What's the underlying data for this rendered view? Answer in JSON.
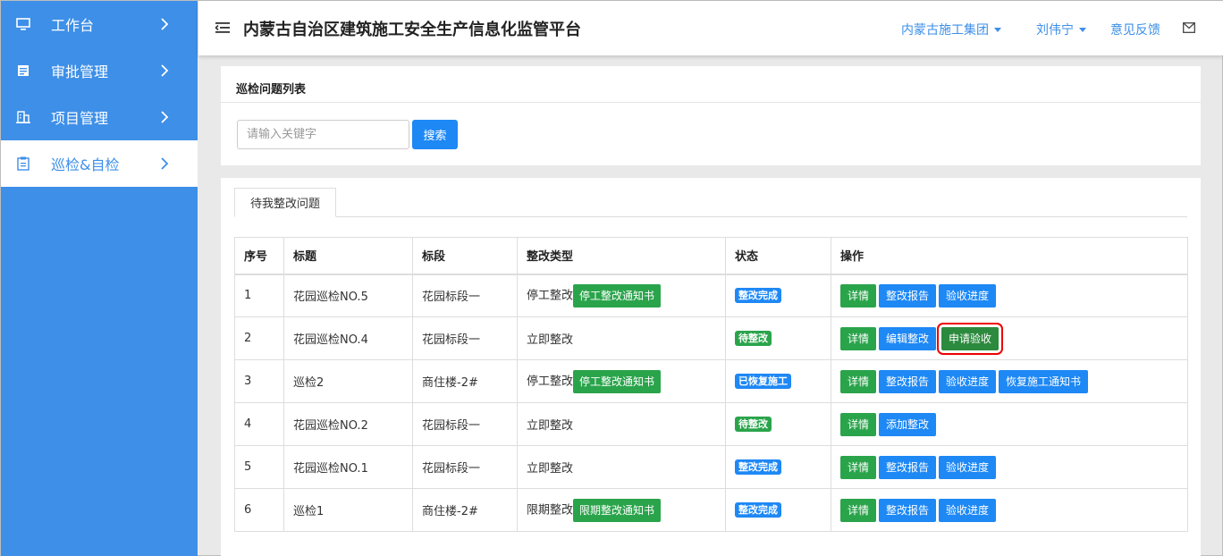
{
  "sidebar": {
    "items": [
      {
        "label": "工作台",
        "icon": "monitor-icon",
        "active": false
      },
      {
        "label": "审批管理",
        "icon": "document-stack-icon",
        "active": false
      },
      {
        "label": "项目管理",
        "icon": "building-icon",
        "active": false
      },
      {
        "label": "巡检&自检",
        "icon": "clipboard-icon",
        "active": true
      }
    ]
  },
  "header": {
    "title": "内蒙古自治区建筑施工安全生产信息化监管平台",
    "org_menu": "内蒙古施工集团",
    "user_menu": "刘伟宁",
    "feedback": "意见反馈"
  },
  "search_panel": {
    "title": "巡检问题列表",
    "placeholder": "请输入关键字",
    "search_label": "搜索"
  },
  "list_panel": {
    "tab": "待我整改问题",
    "columns": [
      "序号",
      "标题",
      "标段",
      "整改类型",
      "状态",
      "操作"
    ],
    "rows": [
      {
        "no": "1",
        "title": "花园巡检NO.5",
        "section": "花园标段一",
        "type": "停工整改",
        "notice": "停工整改通知书",
        "status": "整改完成",
        "actions": [
          "详情",
          "整改报告",
          "验收进度"
        ]
      },
      {
        "no": "2",
        "title": "花园巡检NO.4",
        "section": "花园标段一",
        "type": "立即整改",
        "notice": "",
        "status": "待整改",
        "actions": [
          "详情",
          "编辑整改",
          "申请验收"
        ]
      },
      {
        "no": "3",
        "title": "巡检2",
        "section": "商住楼-2#",
        "type": "停工整改",
        "notice": "停工整改通知书",
        "status": "已恢复施工",
        "actions": [
          "详情",
          "整改报告",
          "验收进度",
          "恢复施工通知书"
        ]
      },
      {
        "no": "4",
        "title": "花园巡检NO.2",
        "section": "花园标段一",
        "type": "立即整改",
        "notice": "",
        "status": "待整改",
        "actions": [
          "详情",
          "添加整改"
        ]
      },
      {
        "no": "5",
        "title": "花园巡检NO.1",
        "section": "花园标段一",
        "type": "立即整改",
        "notice": "",
        "status": "整改完成",
        "actions": [
          "详情",
          "整改报告",
          "验收进度"
        ]
      },
      {
        "no": "6",
        "title": "巡检1",
        "section": "商住楼-2#",
        "type": "限期整改",
        "notice": "限期整改通知书",
        "status": "整改完成",
        "actions": [
          "详情",
          "整改报告",
          "验收进度"
        ]
      }
    ]
  },
  "colors": {
    "sidebar_bg": "#3d8fe8",
    "primary": "#1e88f5",
    "success": "#2aa44b",
    "highlight": "#e00000"
  }
}
